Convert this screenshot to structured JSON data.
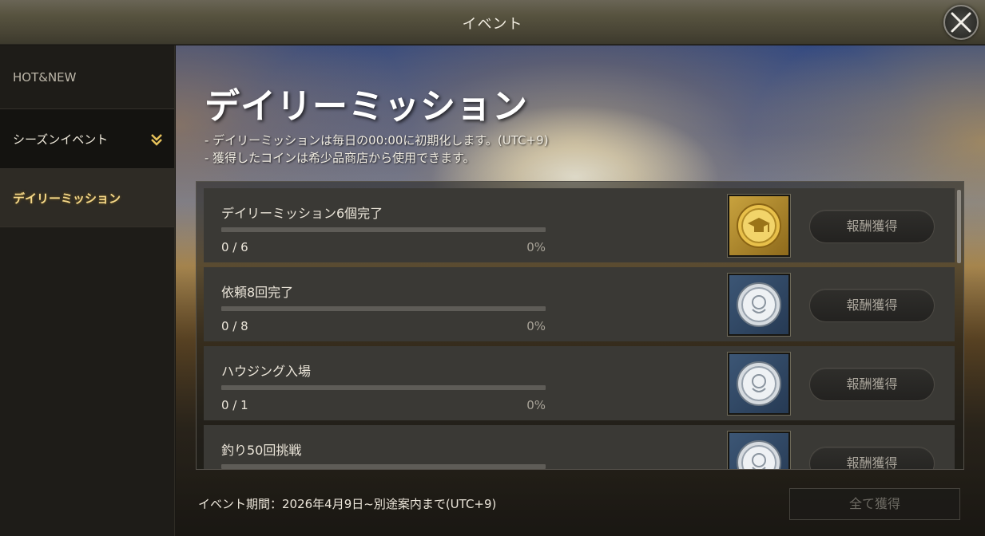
{
  "window": {
    "title": "イベント"
  },
  "sidebar": {
    "items": [
      {
        "label": "HOT&NEW"
      },
      {
        "label": "シーズンイベント"
      },
      {
        "label": "デイリーミッション"
      }
    ]
  },
  "main": {
    "heading": "デイリーミッション",
    "notes": [
      "- デイリーミッションは毎日の00:00に初期化します。(UTC+9)",
      "- 獲得したコインは希少品商店から使用できます。"
    ],
    "missions": [
      {
        "name": "デイリーミッション6個完了",
        "count": "0 / 6",
        "percent": "0%",
        "progress": 0,
        "reward": "gold-coin-icon",
        "button": "報酬獲得"
      },
      {
        "name": "依頼8回完了",
        "count": "0 / 8",
        "percent": "0%",
        "progress": 0,
        "reward": "silver-coin-icon",
        "button": "報酬獲得"
      },
      {
        "name": "ハウジング入場",
        "count": "0 / 1",
        "percent": "0%",
        "progress": 0,
        "reward": "silver-coin-icon",
        "button": "報酬獲得"
      },
      {
        "name": "釣り50回挑戦",
        "count": "",
        "percent": "",
        "progress": 0,
        "reward": "silver-coin-icon",
        "button": "報酬獲得"
      }
    ],
    "footer": {
      "period": "イベント期間：2026年4月9日~別途案内まで(UTC+9)",
      "claim_all": "全て獲得"
    }
  },
  "colors": {
    "accent_gold": "#f6d98a",
    "button_text": "#a9a49a",
    "disabled_text": "#6d6a63"
  }
}
